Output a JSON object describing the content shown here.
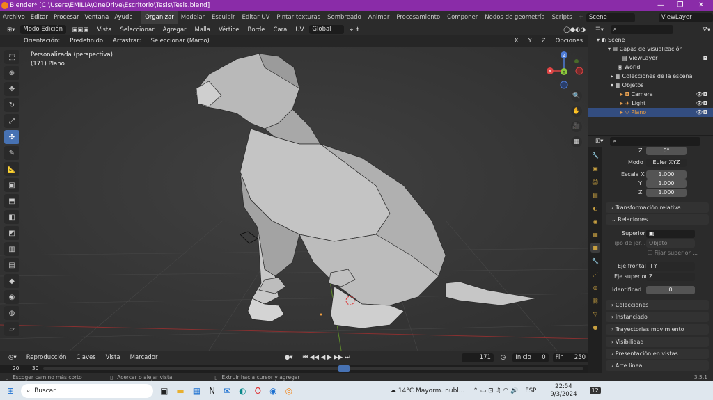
{
  "window": {
    "title": "Blender* [C:\\Users\\EMILIA\\OneDrive\\Escritorio\\Tesis\\Tesis.blend]"
  },
  "menus": [
    "Archivo",
    "Editar",
    "Procesar",
    "Ventana",
    "Ayuda"
  ],
  "workspaces": [
    "Organizar",
    "Modelar",
    "Esculpir",
    "Editar UV",
    "Pintar texturas",
    "Sombreado",
    "Animar",
    "Procesamiento",
    "Componer",
    "Nodos de geometría",
    "Scripts"
  ],
  "scene": {
    "label": "Scene",
    "viewlayer": "ViewLayer"
  },
  "header": {
    "mode": "Modo Edición",
    "menus": [
      "Vista",
      "Seleccionar",
      "Agregar",
      "Malla",
      "Vértice",
      "Borde",
      "Cara",
      "UV"
    ],
    "transform": "Global"
  },
  "header2": {
    "orientation_label": "Orientación:",
    "orientation_value": "Predefinido",
    "drag_label": "Arrastrar:",
    "drag_value": "Seleccionar (Marco)",
    "options": "Opciones",
    "axes": [
      "X",
      "Y",
      "Z"
    ]
  },
  "viewport": {
    "view_name": "Personalizada (perspectiva)",
    "object_info": "(171) Plano"
  },
  "gizmo": {
    "x": "X",
    "y": "Y",
    "z": "Z"
  },
  "outliner": {
    "rows": [
      {
        "label": "Scene"
      },
      {
        "label": "Capas de visualización"
      },
      {
        "label": "ViewLayer"
      },
      {
        "label": "World"
      },
      {
        "label": "Colecciones de la escena"
      },
      {
        "label": "Objetos"
      },
      {
        "label": "Camera"
      },
      {
        "label": "Light"
      },
      {
        "label": "Plano"
      }
    ]
  },
  "properties": {
    "rot_z_label": "Z",
    "rot_z_value": "0°",
    "mode_label": "Modo",
    "mode_value": "Euler XYZ",
    "scale_x_label": "Escala X",
    "scale_x": "1.000",
    "scale_y_label": "Y",
    "scale_y": "1.000",
    "scale_z_label": "Z",
    "scale_z": "1.000",
    "relative": "Transformación relativa",
    "relations": "Relaciones",
    "parent_label": "Superior",
    "parent_type_label": "Tipo de jer...",
    "parent_type_value": "Objeto",
    "fix_parent": "Fijar superior ...",
    "front_axis_label": "Eje frontal",
    "front_axis_value": "+Y",
    "up_axis_label": "Eje superior",
    "up_axis_value": "Z",
    "id_label": "Identificad...",
    "id_value": "0",
    "sections": [
      "Colecciones",
      "Instanciado",
      "Trayectorias movimiento",
      "Visibilidad",
      "Presentación en vistas",
      "Arte lineal"
    ]
  },
  "timeline": {
    "menus": [
      "Reproducción",
      "Claves",
      "Vista",
      "Marcador"
    ],
    "current": "171",
    "start_label": "Inicio",
    "start": "0",
    "end_label": "Fin",
    "end": "250",
    "ruler": [
      "20",
      "30"
    ]
  },
  "status": {
    "left": "Escoger camino más corto",
    "mid": "Acercar o alejar vista",
    "right": "Extruir hacia cursor y agregar",
    "version": "3.5.1"
  },
  "taskbar": {
    "search": "Buscar",
    "weather": "14°C  Mayorm. nubl...",
    "lang": "ESP",
    "time": "22:54",
    "date": "9/3/2024",
    "notif": "12"
  },
  "colors": {
    "accent": "#4772b3",
    "title": "#8a2ca8",
    "viewport": "#3b3b3b"
  }
}
